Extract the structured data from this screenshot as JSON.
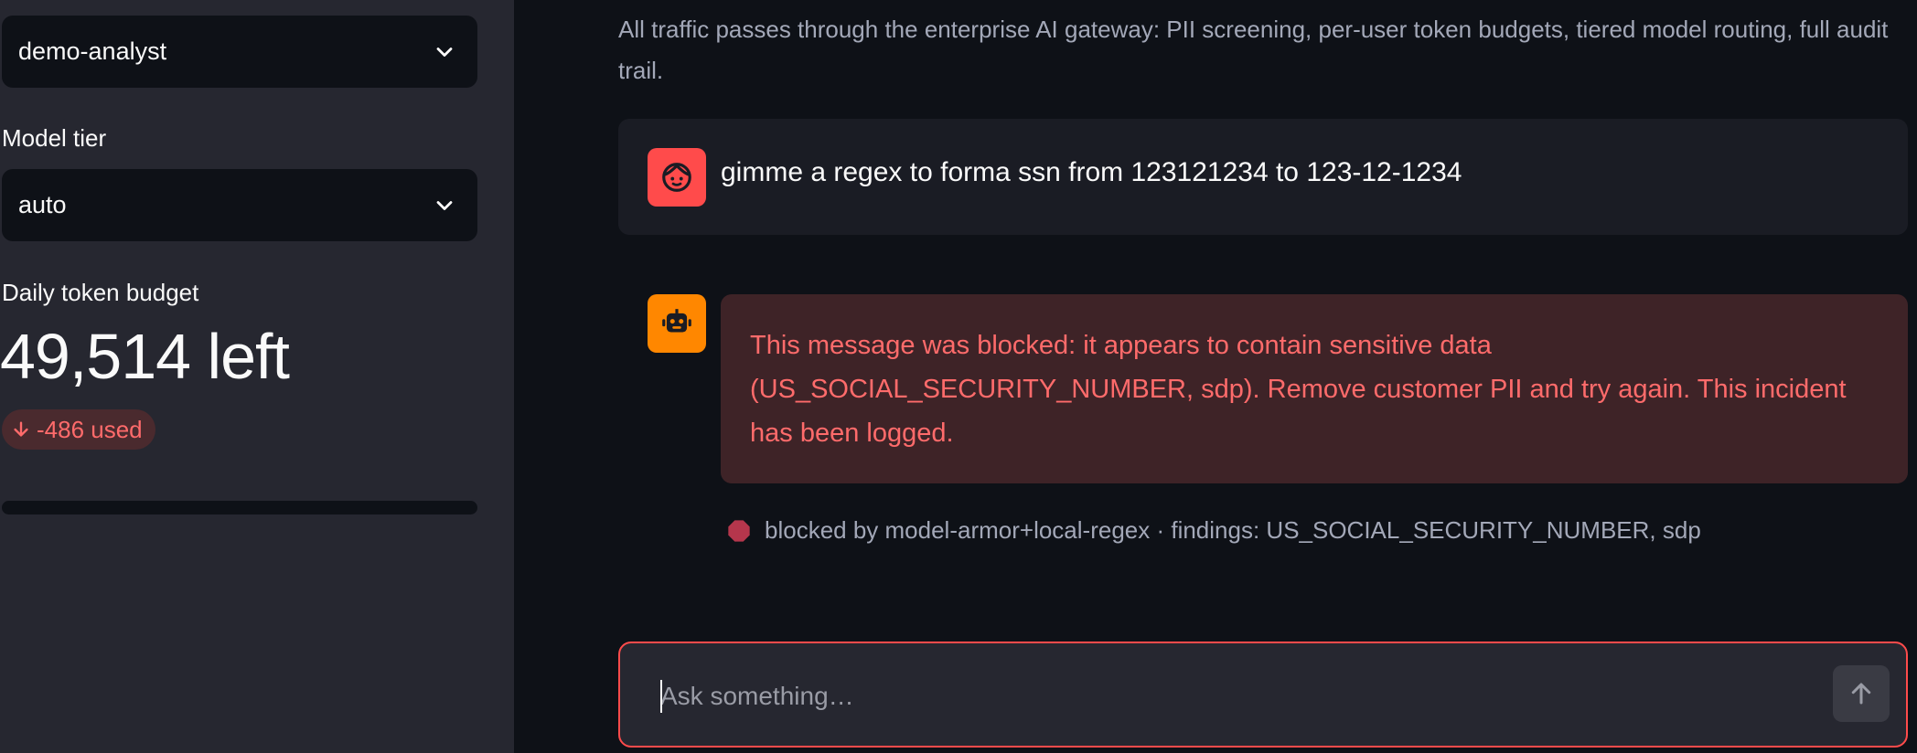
{
  "sidebar": {
    "user_select": {
      "value": "demo-analyst"
    },
    "model_tier": {
      "label": "Model tier",
      "value": "auto"
    },
    "budget": {
      "label": "Daily token budget",
      "value": "49,514 left",
      "delta": "-486 used",
      "delta_color": "#ff6b6b"
    }
  },
  "main": {
    "caption": "All traffic passes through the enterprise AI gateway: PII screening, per-user token budgets, tiered model routing, full audit trail.",
    "user_message": {
      "avatar_icon": "user-face-icon",
      "avatar_color": "#ff4b4b",
      "text": "gimme a regex to forma ssn from 123121234 to 123-12-1234"
    },
    "assistant_message": {
      "avatar_icon": "robot-icon",
      "avatar_color": "#ff8700",
      "error_text": "This message was blocked: it appears to contain sensitive data (US_SOCIAL_SECURITY_NUMBER, sdp). Remove customer PII and try again. This incident has been logged.",
      "footnote": "blocked by model-armor+local-regex · findings: US_SOCIAL_SECURITY_NUMBER, sdp",
      "footnote_icon": "stop-sign-icon"
    },
    "chat_input": {
      "placeholder": "Ask something…",
      "send_icon": "arrow-up-icon"
    }
  }
}
